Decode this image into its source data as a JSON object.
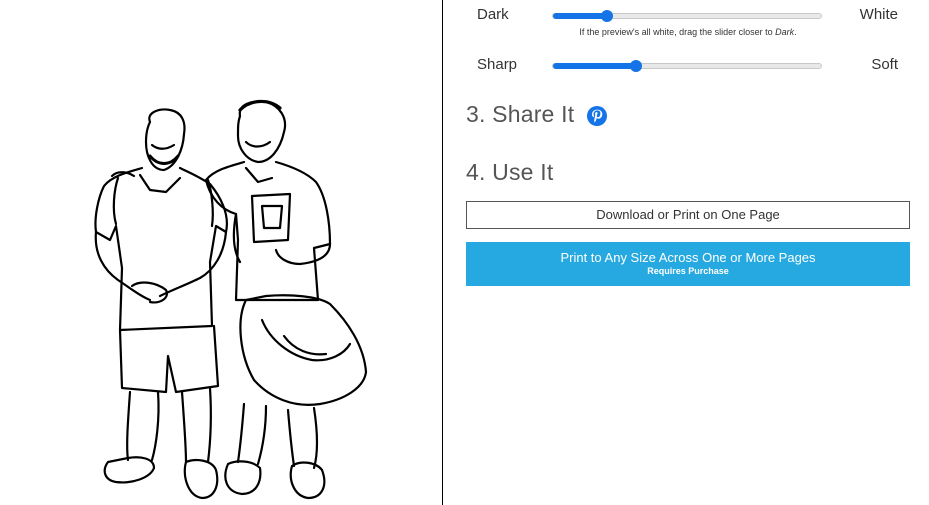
{
  "sliders": {
    "darkness": {
      "left_label": "Dark",
      "right_label": "White",
      "value": 0.2
    },
    "softness": {
      "left_label": "Sharp",
      "right_label": "Soft",
      "value": 0.31
    },
    "hint_prefix": "If the preview's all white, drag the slider closer to ",
    "hint_emphasis": "Dark",
    "hint_suffix": "."
  },
  "share": {
    "title": "3. Share It",
    "icon": "pinterest-icon",
    "icon_color": "#1473e6"
  },
  "use": {
    "title": "4. Use It",
    "download_label": "Download or Print on One Page",
    "print_label": "Print to Any Size Across One or More Pages",
    "print_sublabel": "Requires Purchase"
  },
  "colors": {
    "accent": "#1473e6",
    "primary_button": "#26a9e0"
  }
}
